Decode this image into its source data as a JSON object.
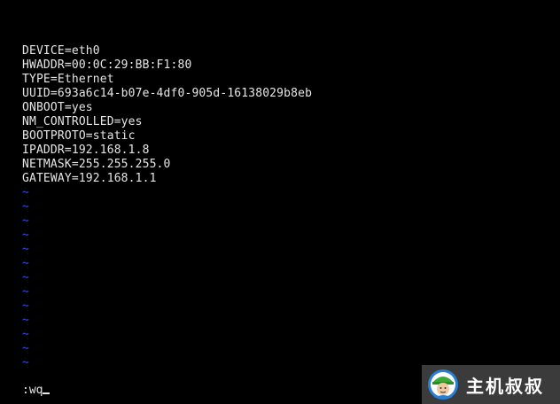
{
  "file_lines": [
    "DEVICE=eth0",
    "HWADDR=00:0C:29:BB:F1:80",
    "TYPE=Ethernet",
    "UUID=693a6c14-b07e-4df0-905d-16138029b8eb",
    "ONBOOT=yes",
    "NM_CONTROLLED=yes",
    "BOOTPROTO=static",
    "IPADDR=192.168.1.8",
    "NETMASK=255.255.255.0",
    "GATEWAY=192.168.1.1"
  ],
  "empty_line_marker": "~",
  "command_line": ":wq",
  "watermark": {
    "text": "主机叔叔"
  },
  "colors": {
    "background": "#000000",
    "text": "#e6e6e6",
    "tilde": "#1f3fbf",
    "watermark_bg": "#3b3b3b"
  }
}
